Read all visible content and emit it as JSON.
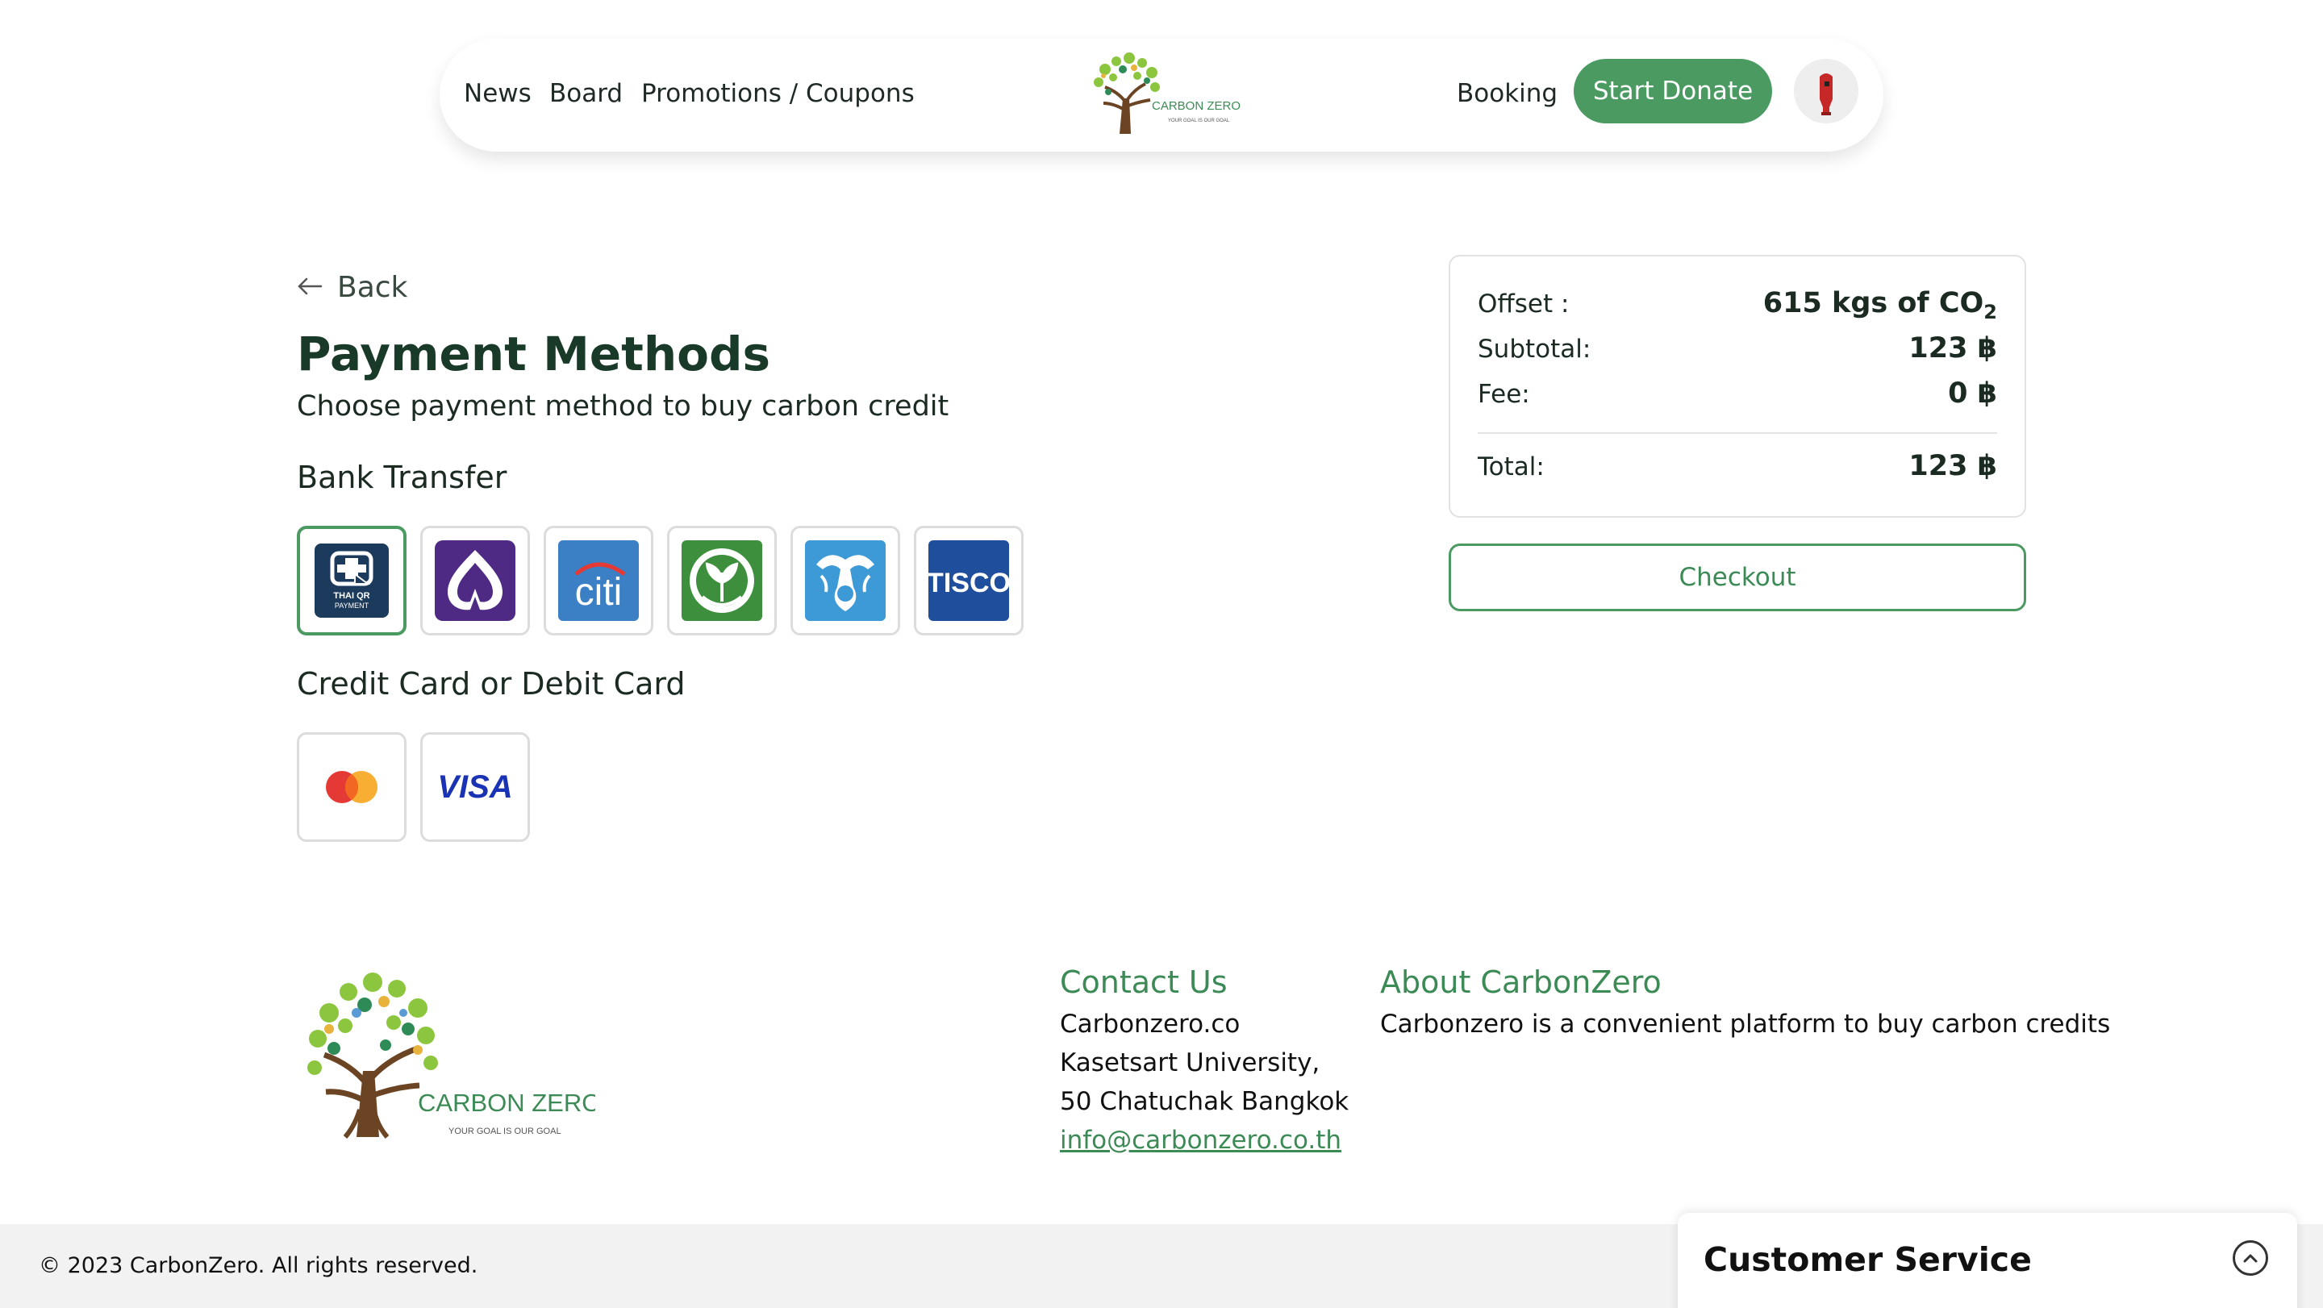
{
  "nav": {
    "links": [
      "News",
      "Board",
      "Promotions / Coupons"
    ],
    "booking": "Booking",
    "donate": "Start Donate",
    "logo_text": "CARBON ZERO",
    "logo_tagline": "YOUR GOAL IS OUR GOAL"
  },
  "page": {
    "back": "Back",
    "title": "Payment Methods",
    "subtitle": "Choose payment method to buy carbon credit",
    "bank_heading": "Bank Transfer",
    "card_heading": "Credit Card or Debit Card"
  },
  "banks": [
    {
      "name": "thai-qr-payment",
      "label_line1": "THAI QR",
      "label_line2": "PAYMENT",
      "selected": true
    },
    {
      "name": "scb",
      "selected": false
    },
    {
      "name": "citi",
      "label": "citi",
      "selected": false
    },
    {
      "name": "kasikorn",
      "selected": false
    },
    {
      "name": "krungthai",
      "selected": false
    },
    {
      "name": "tisco",
      "label": "TISCO",
      "selected": false
    }
  ],
  "cards": [
    {
      "name": "mastercard"
    },
    {
      "name": "visa",
      "label": "VISA"
    }
  ],
  "summary": {
    "offset_label": "Offset :",
    "offset_value": "615 kgs of CO",
    "offset_sub": "2",
    "subtotal_label": "Subtotal:",
    "subtotal_value": "123 ฿",
    "fee_label": "Fee:",
    "fee_value": "0 ฿",
    "total_label": "Total:",
    "total_value": "123 ฿"
  },
  "checkout": "Checkout",
  "footer": {
    "logo_text": "CARBON ZERO",
    "logo_tagline": "YOUR GOAL IS OUR GOAL",
    "contact_heading": "Contact Us",
    "contact_lines": [
      "Carbonzero.co",
      "Kasetsart University,",
      "50 Chatuchak Bangkok"
    ],
    "email": "info@carbonzero.co.th",
    "about_heading": "About CarbonZero",
    "about_text": "Carbonzero is a convenient platform to buy carbon credits",
    "copyright": "© 2023 CarbonZero. All rights reserved."
  },
  "customer_service": "Customer Service",
  "colors": {
    "brand_green": "#4a9a62",
    "link_green": "#3c8a55",
    "title_green": "#193a28",
    "scb_purple": "#4e2a84",
    "citi_blue": "#3b7fc4",
    "kbank_green": "#3d8f3d",
    "ktb_blue": "#3d9ad6",
    "tisco_blue": "#1f4e9c",
    "visa_blue": "#1a33b5"
  }
}
